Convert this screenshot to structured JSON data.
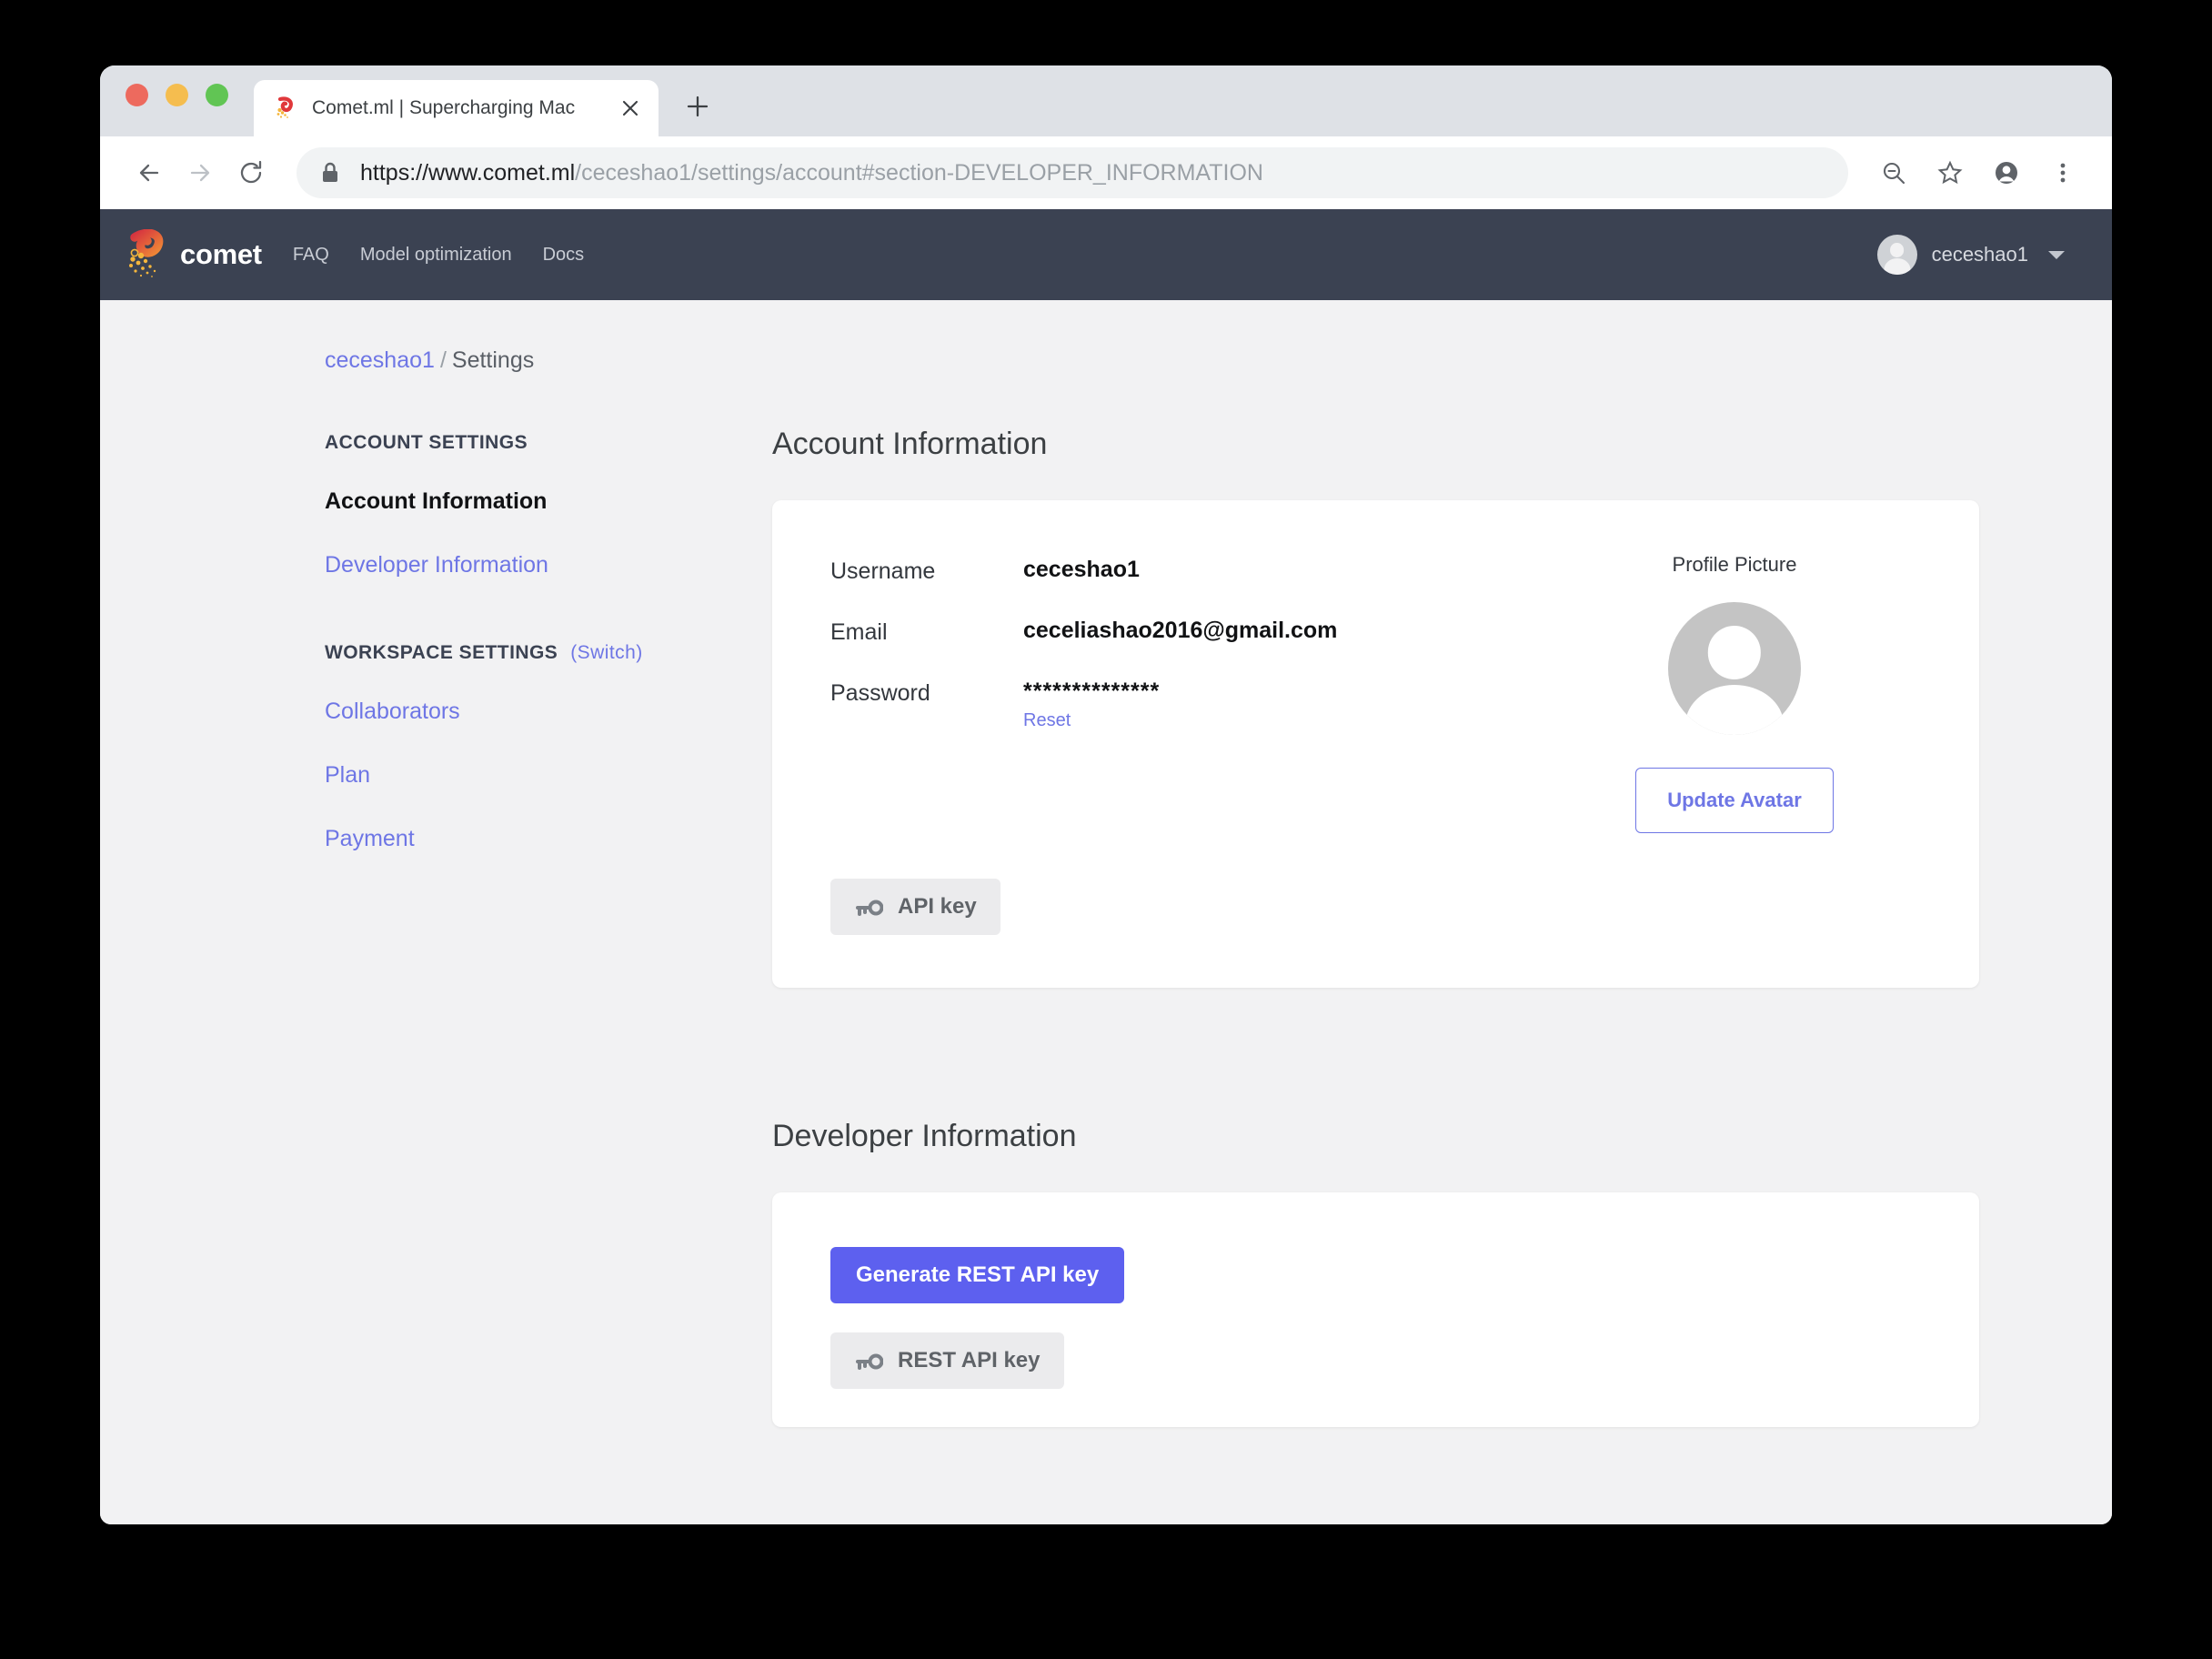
{
  "browser": {
    "tab": {
      "title": "Comet.ml | Supercharging Mac",
      "favicon_icon": "comet-favicon",
      "close_icon": "close-icon"
    },
    "new_tab_icon": "plus-icon",
    "back_icon": "arrow-left-icon",
    "forward_icon": "arrow-right-icon",
    "reload_icon": "reload-icon",
    "lock_icon": "lock-icon",
    "url": {
      "scheme_host": "https://www.comet.ml",
      "path": "/ceceshao1/settings/account#section-DEVELOPER_INFORMATION"
    },
    "toolbar_icons": [
      "zoom-out-icon",
      "bookmark-star-icon",
      "profile-icon",
      "more-vertical-icon"
    ]
  },
  "navbar": {
    "brand_name": "comet",
    "brand_logo_icon": "comet-logo-icon",
    "links": [
      {
        "label": "FAQ"
      },
      {
        "label": "Model optimization"
      },
      {
        "label": "Docs"
      }
    ],
    "user": {
      "name": "ceceshao1",
      "avatar_icon": "user-avatar-icon",
      "caret_icon": "chevron-down-icon"
    }
  },
  "breadcrumb": {
    "workspace": "ceceshao1",
    "separator": "/",
    "current": "Settings"
  },
  "sidebar": {
    "account_heading": "ACCOUNT SETTINGS",
    "account_items": [
      {
        "label": "Account Information",
        "active": true
      },
      {
        "label": "Developer Information",
        "active": false
      }
    ],
    "workspace_heading": "WORKSPACE SETTINGS",
    "workspace_switch": "(Switch)",
    "workspace_items": [
      {
        "label": "Collaborators"
      },
      {
        "label": "Plan"
      },
      {
        "label": "Payment"
      }
    ]
  },
  "account_section": {
    "title": "Account Information",
    "fields": {
      "username_label": "Username",
      "username_value": "ceceshao1",
      "email_label": "Email",
      "email_value": "ceceliashao2016@gmail.com",
      "password_label": "Password",
      "password_value": "**************",
      "reset_label": "Reset"
    },
    "profile_picture_label": "Profile Picture",
    "profile_picture_icon": "default-avatar-icon",
    "update_avatar_label": "Update Avatar",
    "api_key_label": "API key",
    "api_key_icon": "key-icon"
  },
  "developer_section": {
    "title": "Developer Information",
    "generate_label": "Generate REST API key",
    "rest_api_key_label": "REST API key",
    "rest_api_key_icon": "key-icon"
  },
  "colors": {
    "accent": "#6e76e5",
    "primary_button": "#5d60ef",
    "navbar_bg": "#3b4252",
    "page_bg": "#f2f2f3"
  }
}
